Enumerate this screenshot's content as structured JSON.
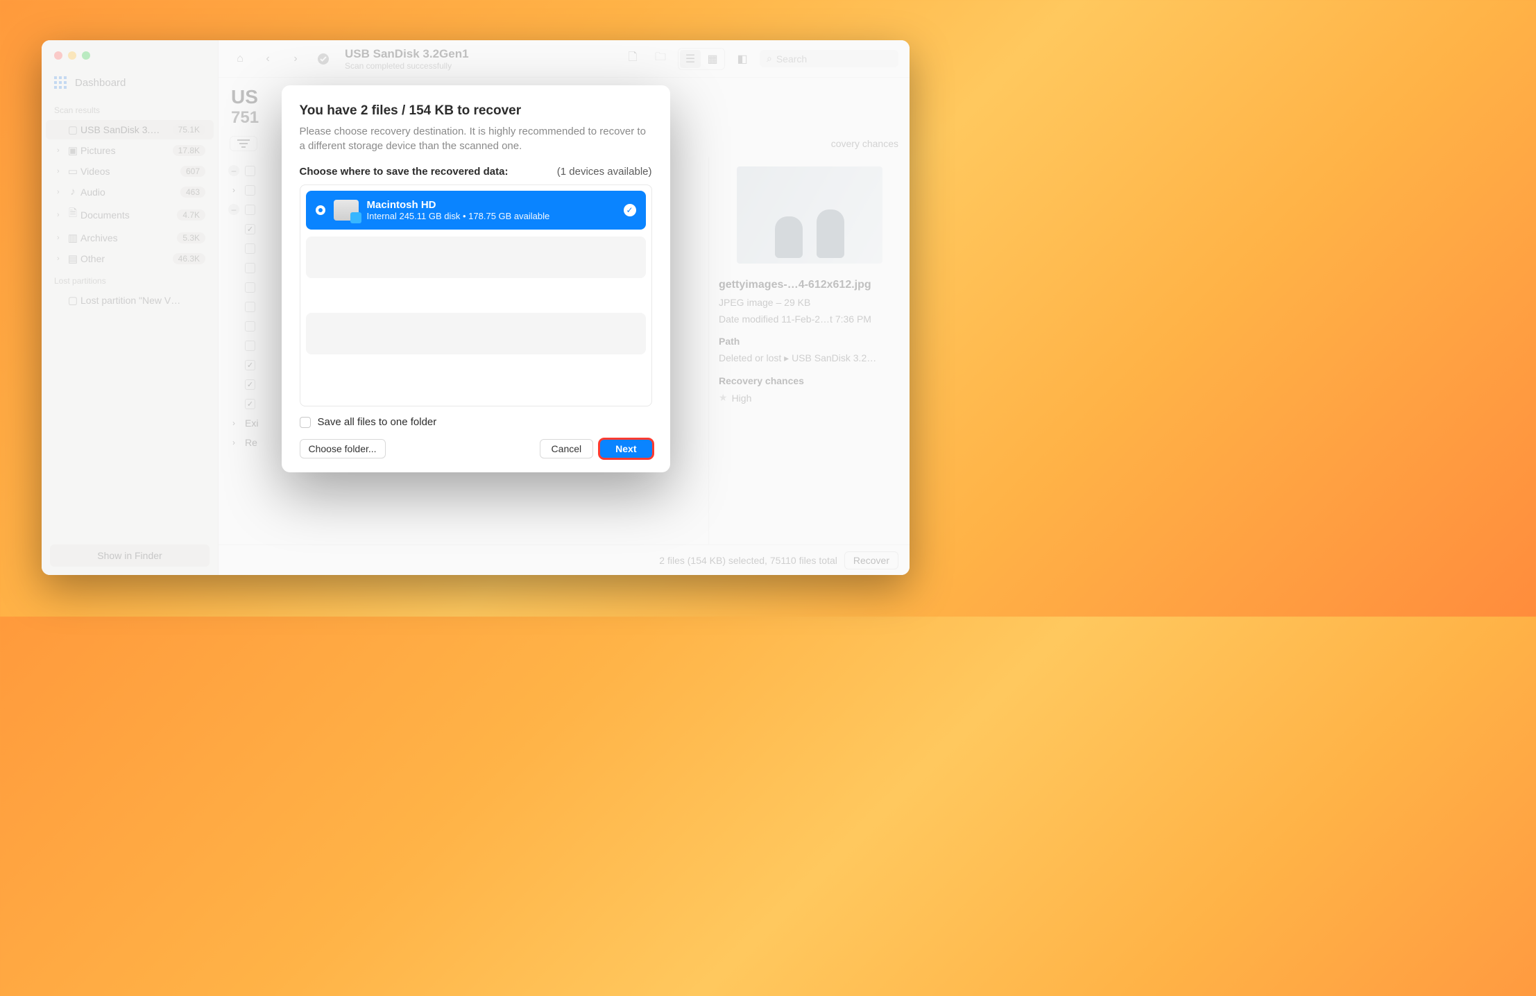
{
  "toolbar": {
    "title": "USB  SanDisk 3.2Gen1",
    "subtitle": "Scan completed successfully",
    "search_placeholder": "Search"
  },
  "sidebar": {
    "dashboard": "Dashboard",
    "scan_results_heading": "Scan results",
    "lost_partitions_heading": "Lost partitions",
    "items": [
      {
        "icon": "drive",
        "label": "USB  SanDisk 3.…",
        "badge": "75.1K",
        "active": true
      },
      {
        "icon": "image",
        "label": "Pictures",
        "badge": "17.8K",
        "chev": true
      },
      {
        "icon": "video",
        "label": "Videos",
        "badge": "607",
        "chev": true
      },
      {
        "icon": "audio",
        "label": "Audio",
        "badge": "463",
        "chev": true
      },
      {
        "icon": "doc",
        "label": "Documents",
        "badge": "4.7K",
        "chev": true
      },
      {
        "icon": "archive",
        "label": "Archives",
        "badge": "5.3K",
        "chev": true
      },
      {
        "icon": "other",
        "label": "Other",
        "badge": "46.3K",
        "chev": true
      }
    ],
    "lost_item": "Lost partition \"New V…",
    "show_in_finder": "Show in Finder"
  },
  "subheader": {
    "big": "US",
    "count": "751"
  },
  "filterbar": {
    "right_label": "covery chances"
  },
  "rows": [
    {
      "exp": "–",
      "cb": false
    },
    {
      "exp": ">",
      "cb": false
    },
    {
      "exp": "–",
      "cb": false
    },
    {
      "exp": "",
      "cb": true
    },
    {
      "exp": "",
      "cb": false
    },
    {
      "exp": "",
      "cb": false
    },
    {
      "exp": "",
      "cb": false
    },
    {
      "exp": "",
      "cb": false
    },
    {
      "exp": "",
      "cb": false
    },
    {
      "exp": "",
      "cb": false
    },
    {
      "exp": "",
      "cb": true
    },
    {
      "exp": "",
      "cb": true
    },
    {
      "exp": "",
      "cb": true
    },
    {
      "exp": ">",
      "cb": false,
      "label": "Exi"
    },
    {
      "exp": ">",
      "cb": false,
      "label": "Re"
    }
  ],
  "preview": {
    "filename": "gettyimages-…4-612x612.jpg",
    "meta": "JPEG image – 29 KB",
    "date": "Date modified  11-Feb-2…t 7:36 PM",
    "path_label": "Path",
    "path_value": "Deleted or lost ▸ USB  SanDisk 3.2…",
    "chances_label": "Recovery chances",
    "chances_value": "High"
  },
  "statusbar": {
    "summary": "2 files (154 KB) selected, 75110 files total",
    "recover": "Recover"
  },
  "modal": {
    "title": "You have 2 files / 154 KB to recover",
    "desc": "Please choose recovery destination. It is highly recommended to recover to a different storage device than the scanned one.",
    "choose_label": "Choose where to save the recovered data:",
    "devices_available": "(1 devices available)",
    "dest_name": "Macintosh HD",
    "dest_sub": "Internal 245.11 GB disk • 178.75 GB available",
    "save_one": "Save all files to one folder",
    "choose_folder": "Choose folder...",
    "cancel": "Cancel",
    "next": "Next"
  }
}
